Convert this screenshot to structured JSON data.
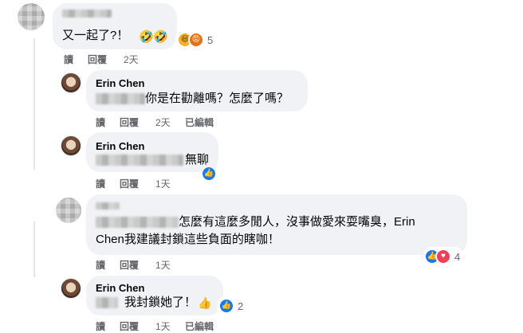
{
  "comments": [
    {
      "author": "",
      "text": "又一起了?！",
      "reaction_count": "5",
      "actions": {
        "reply_a": "讀",
        "reply_b": "回覆",
        "time": "2天"
      }
    },
    {
      "author": "Erin Chen",
      "text": "你是在勸離嗎？怎麼了嗎？",
      "actions": {
        "reply_a": "讀",
        "reply_b": "回覆",
        "time": "2天",
        "edited": "已編輯"
      }
    },
    {
      "author": "Erin Chen",
      "text": "無聊",
      "actions": {
        "reply_a": "讀",
        "reply_b": "回覆",
        "time": "1天"
      }
    },
    {
      "author": "",
      "text_line1": "怎麼有這麼多閒人，沒事做愛來耍嘴臭，Erin",
      "text_line2": "Chen我建議封鎖這些負面的瞎咖！",
      "reaction_count": "4",
      "actions": {
        "reply_a": "讀",
        "reply_b": "回覆",
        "time": "1天"
      }
    },
    {
      "author": "Erin Chen",
      "text": "我封鎖她了！",
      "reaction_count": "2",
      "actions": {
        "reply_a": "讀",
        "reply_b": "回覆",
        "time": "1天",
        "edited": "已編輯"
      }
    }
  ],
  "colors": {
    "like_blue": "#1877f2",
    "love_red": "#f33e58",
    "haha_yellow": "#f7b125",
    "angry_orange": "#e9710f"
  },
  "icons": [
    "laugh-emoji-icon",
    "like-reaction-icon",
    "love-reaction-icon",
    "haha-reaction-icon",
    "angry-reaction-icon",
    "thumbs-up-emoji-icon"
  ]
}
